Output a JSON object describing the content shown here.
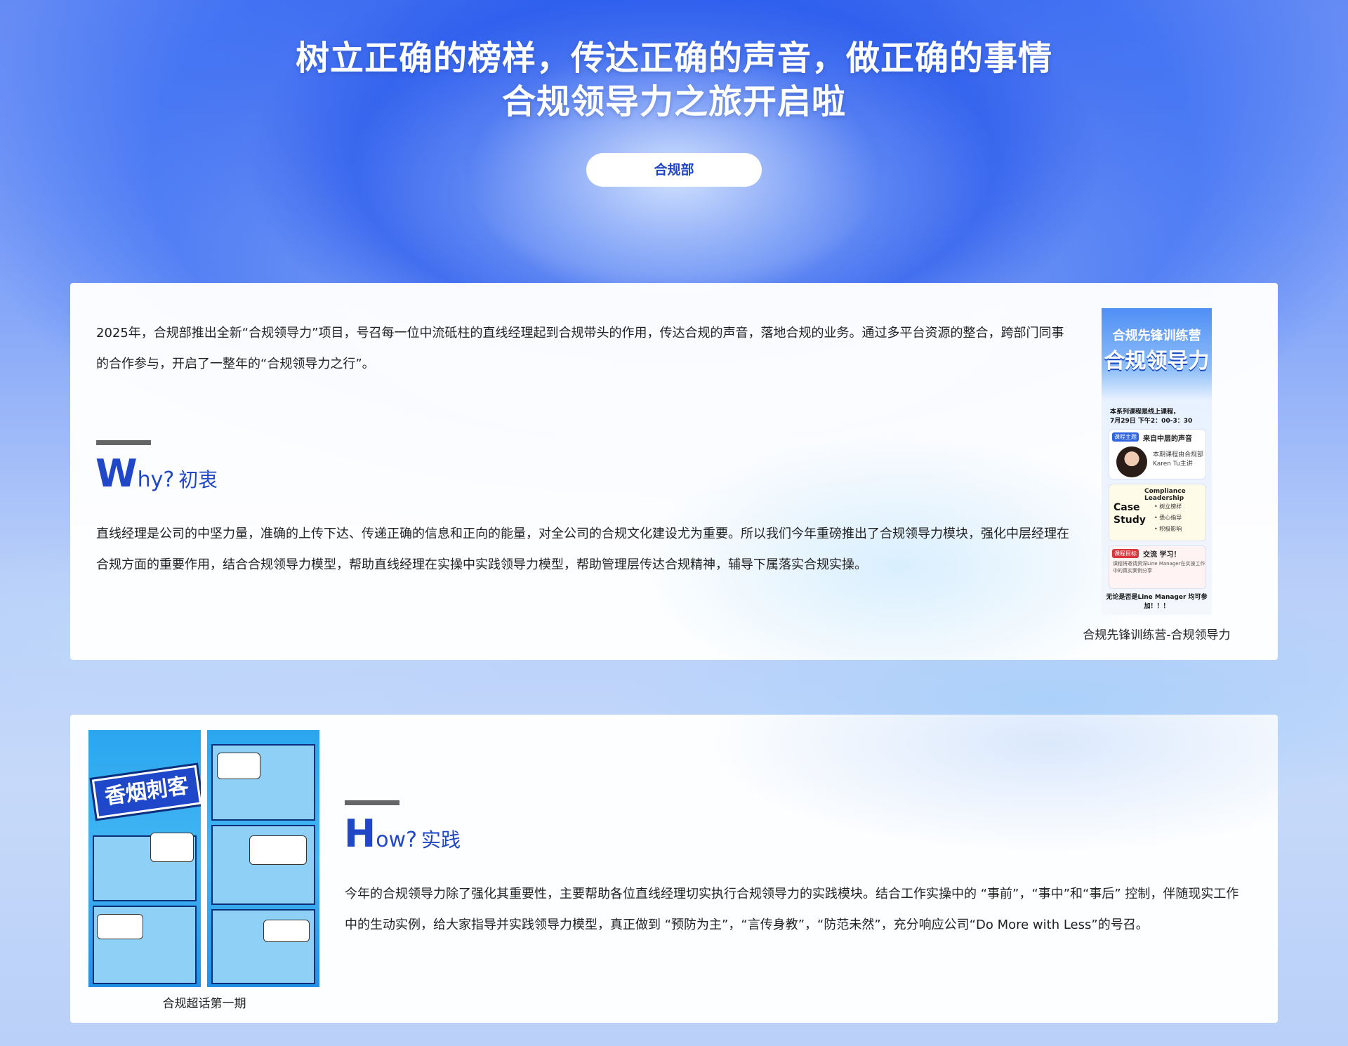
{
  "hero": {
    "title_line1": "树立正确的榜样，传达正确的声音，做正确的事情",
    "title_line2": "合规领导力之旅开启啦",
    "department": "合规部"
  },
  "intro": {
    "text": "2025年，合规部推出全新“合规领导力”项目，号召每一位中流砥柱的直线经理起到合规带头的作用，传达合规的声音，落地合规的业务。通过多平台资源的整合，跨部门同事的合作参与，开启了一整年的“合规领导力之行”。"
  },
  "why": {
    "big_letter": "W",
    "rest": "hy?",
    "cn": "初衷",
    "text": "直线经理是公司的中坚力量，准确的上传下达、传递正确的信息和正向的能量，对全公司的合规文化建设尤为重要。所以我们今年重磅推出了合规领导力模块，强化中层经理在合规方面的重要作用，结合合规领导力模型，帮助直线经理在实操中实践领导力模型，帮助管理层传达合规精神，辅导下属落实合规实操。"
  },
  "poster": {
    "title_small": "合规先锋训练营",
    "title_big": "合规领导力",
    "info_line1": "本系列课程是线上课程，",
    "info_line2": "7月29日 下午2：00-3：30",
    "box1_tag": "课程主题",
    "box1_title": "来自中层的声音",
    "box1_desc1": "本期课程由合规部",
    "box1_desc2": "Karen Tu主讲",
    "box2_title": "Compliance Leadership",
    "box2_case1": "Case",
    "box2_case2": "Study",
    "box2_item1": "• 树立榜样",
    "box2_item2": "• 悉心指导",
    "box2_item3": "• 积极影响",
    "box3_tag": "课程目标",
    "box3_title": "交流 学习！",
    "box3_desc": "课程将邀请资深Line Manager在实操工作中的真实案例分享",
    "footer": "无论是否是Line Manager 均可参加！！！",
    "caption": "合规先锋训练营-合规领导力"
  },
  "how": {
    "big_letter": "H",
    "rest": "ow?",
    "cn": "实践",
    "text": "今年的合规领导力除了强化其重要性，主要帮助各位直线经理切实执行合规领导力的实践模块。结合工作实操中的 “事前”，“事中”和“事后” 控制，伴随现实工作中的生动实例，给大家指导并实践领导力模型，真正做到 “预防为主”，“言传身教”，“防范未然”，充分响应公司“Do More with Less”的号召。"
  },
  "comic": {
    "title": "香烟刺客",
    "caption": "合规超话第一期"
  },
  "colors": {
    "accent": "#1f47c7",
    "bar": "#666666"
  }
}
